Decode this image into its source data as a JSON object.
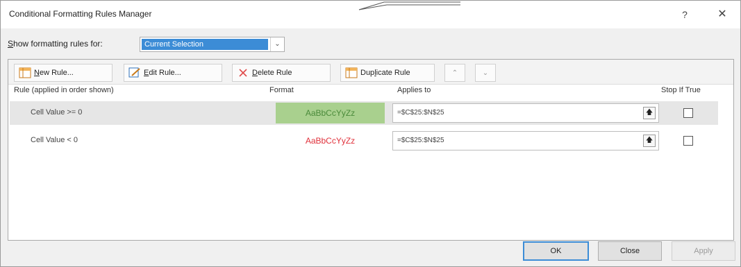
{
  "window": {
    "title": "Conditional Formatting Rules Manager",
    "help_label": "?",
    "close_label": "✕"
  },
  "show_rules": {
    "label_prefix": "S",
    "label_rest": "how formatting rules for:",
    "selected": "Current Selection",
    "arrow": "⌄"
  },
  "toolbar": {
    "new_rule": {
      "u": "N",
      "rest": "ew Rule..."
    },
    "edit_rule": {
      "u": "E",
      "rest": "dit Rule..."
    },
    "delete_rule": {
      "u": "D",
      "rest": "elete Rule"
    },
    "duplicate_rule": {
      "pre": "Dup",
      "u": "l",
      "rest": "icate Rule"
    },
    "move_up": "⌃",
    "move_down": "⌄"
  },
  "columns": {
    "rule": "Rule (applied in order shown)",
    "format": "Format",
    "applies_to": "Applies to",
    "stop_if_true": "Stop If True"
  },
  "rules": [
    {
      "name": "Cell Value >= 0",
      "format_preview": "AaBbCcYyZz",
      "format_bg": "#a9d08e",
      "format_color": "#4a8a3a",
      "applies_to": "=$C$25:$N$25",
      "stop_if_true": false,
      "selected": true
    },
    {
      "name": "Cell Value < 0",
      "format_preview": "AaBbCcYyZz",
      "format_bg": "#ffffff",
      "format_color": "#e0303a",
      "applies_to": "=$C$25:$N$25",
      "stop_if_true": false,
      "selected": false
    }
  ],
  "buttons": {
    "ok": "OK",
    "close": "Close",
    "apply": "Apply"
  },
  "colors": {
    "accent": "#3c8cd6"
  }
}
